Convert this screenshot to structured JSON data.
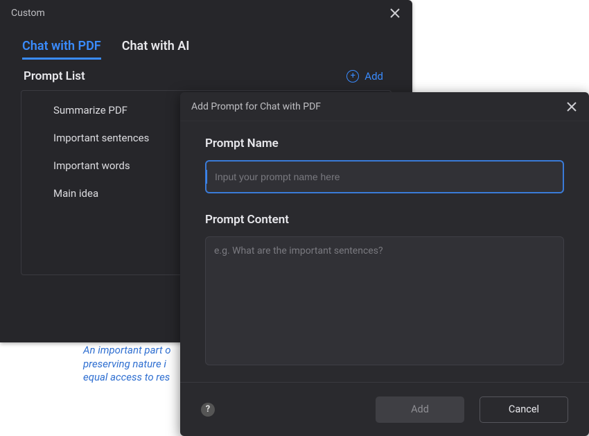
{
  "panel": {
    "title": "Custom",
    "tabs": [
      {
        "label": "Chat with PDF",
        "active": true
      },
      {
        "label": "Chat with AI",
        "active": false
      }
    ],
    "list_title": "Prompt List",
    "add_label": "Add",
    "items": [
      {
        "label": "Summarize PDF"
      },
      {
        "label": "Important sentences"
      },
      {
        "label": "Important words"
      },
      {
        "label": "Main idea"
      }
    ]
  },
  "dialog": {
    "title": "Add Prompt for Chat with PDF",
    "name_label": "Prompt Name",
    "name_placeholder": "Input your prompt name here",
    "name_value": "",
    "content_label": "Prompt Content",
    "content_placeholder": "e.g. What are the important sentences?",
    "content_value": "",
    "help_symbol": "?",
    "add_button": "Add",
    "cancel_button": "Cancel"
  },
  "background_fragment": {
    "line1": "An important part o",
    "line2": "preserving nature i",
    "line3": "equal access to res"
  }
}
